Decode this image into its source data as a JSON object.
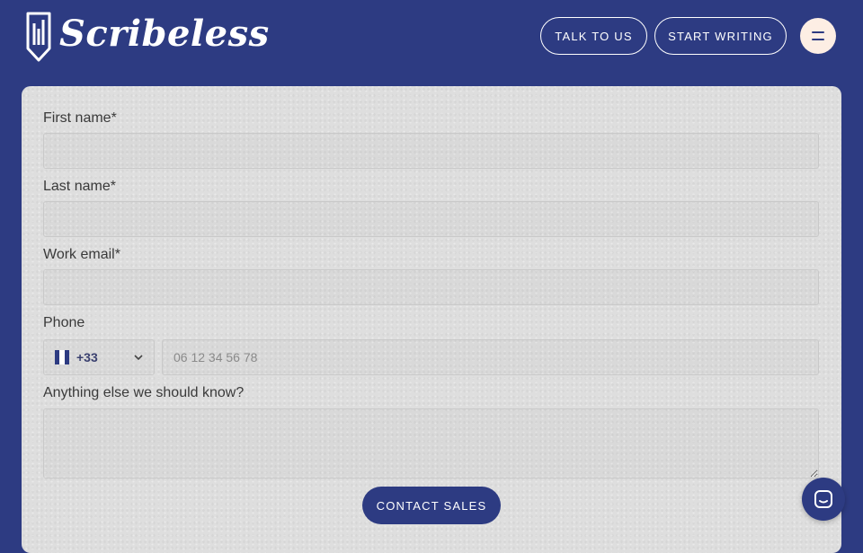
{
  "header": {
    "brand": "Scribeless",
    "talk_label": "TALK TO US",
    "start_label": "START WRITING"
  },
  "form": {
    "first_name_label": "First name*",
    "last_name_label": "Last name*",
    "email_label": "Work email*",
    "phone_label": "Phone",
    "country_code": "+33",
    "phone_placeholder": "06 12 34 56 78",
    "notes_label": "Anything else we should know?",
    "submit_label": "CONTACT SALES"
  },
  "icons": {
    "logo": "pencil-logo-icon",
    "menu": "hamburger-menu-icon",
    "flag": "france-flag-icon",
    "chevron": "chevron-down-icon",
    "chat": "chat-icon"
  },
  "colors": {
    "brand_blue": "#2d3b82",
    "card_bg": "#dedede",
    "menu_bg": "#fdeee4"
  }
}
